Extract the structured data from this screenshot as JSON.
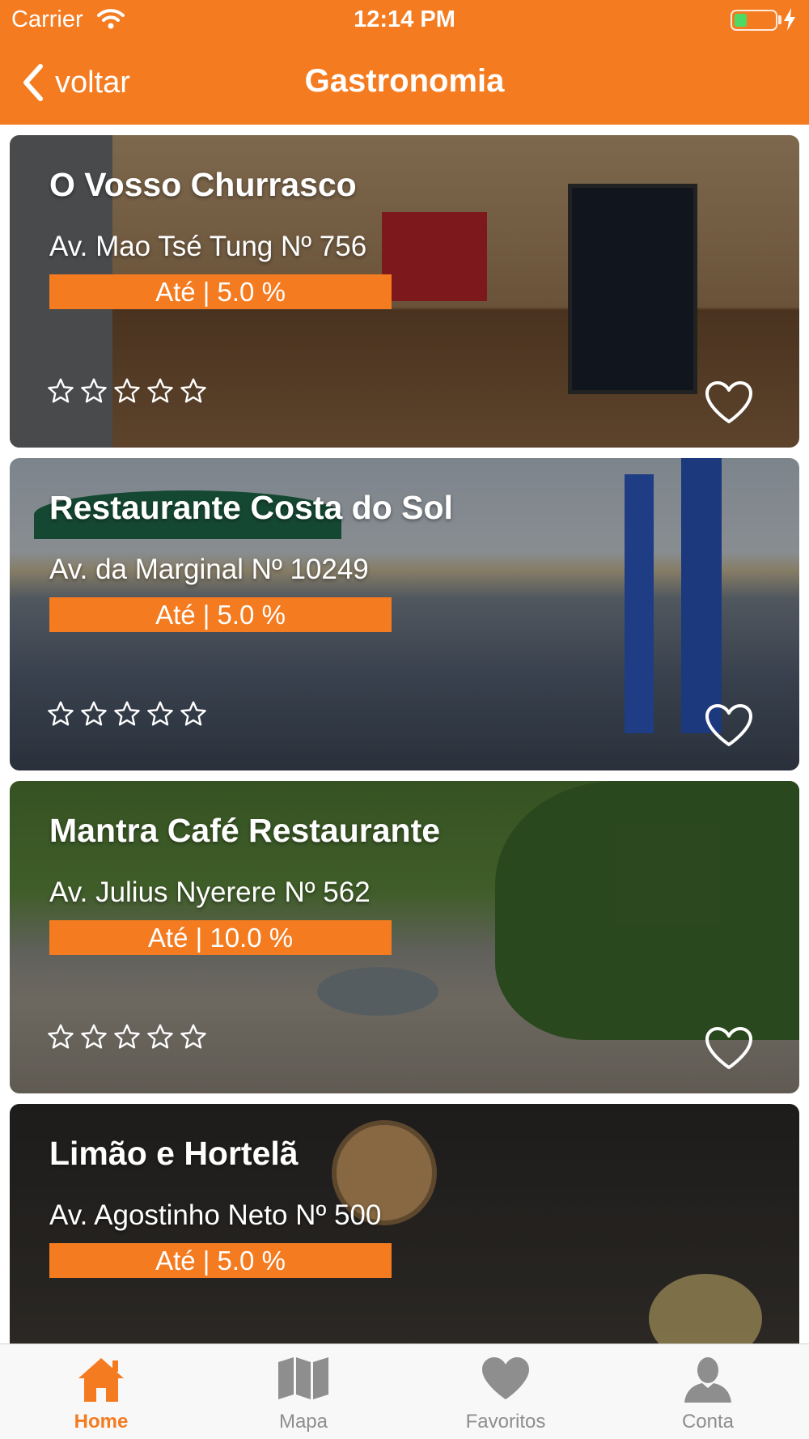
{
  "status_bar": {
    "carrier": "Carrier",
    "time": "12:14 PM"
  },
  "nav": {
    "back_label": "voltar",
    "title": "Gastronomia"
  },
  "colors": {
    "accent": "#F47B20",
    "tab_inactive": "#8E8E8E",
    "rating_star_empty": "#FFFFFF"
  },
  "restaurants": [
    {
      "name": "O Vosso Churrasco",
      "address": "Av. Mao Tsé Tung Nº 756",
      "discount": "Até | 5.0 %",
      "rating": 0,
      "rating_max": 5,
      "favorite": false
    },
    {
      "name": "Restaurante Costa do Sol",
      "address": "Av. da Marginal Nº 10249",
      "discount": "Até | 5.0 %",
      "rating": 0,
      "rating_max": 5,
      "favorite": false
    },
    {
      "name": "Mantra Café Restaurante",
      "address": "Av. Julius Nyerere Nº 562",
      "discount": "Até | 10.0 %",
      "rating": 0,
      "rating_max": 5,
      "favorite": false
    },
    {
      "name": "Limão e Hortelã",
      "address": "Av. Agostinho Neto Nº 500",
      "discount": "Até | 5.0 %"
    }
  ],
  "tabs": [
    {
      "label": "Home",
      "icon": "home-icon",
      "active": true
    },
    {
      "label": "Mapa",
      "icon": "map-icon",
      "active": false
    },
    {
      "label": "Favoritos",
      "icon": "heart-icon",
      "active": false
    },
    {
      "label": "Conta",
      "icon": "person-icon",
      "active": false
    }
  ]
}
